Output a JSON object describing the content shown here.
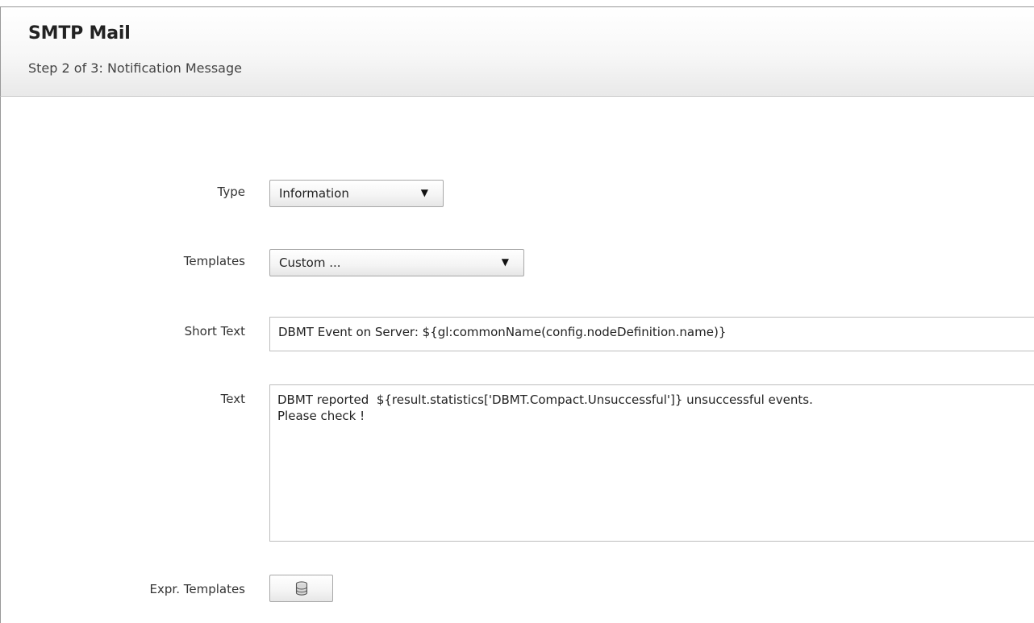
{
  "header": {
    "title": "SMTP Mail",
    "subtitle": "Step 2 of 3: Notification Message"
  },
  "form": {
    "type": {
      "label": "Type",
      "value": "Information"
    },
    "templates": {
      "label": "Templates",
      "value": "Custom ..."
    },
    "short_text": {
      "label": "Short Text",
      "value": "DBMT Event on Server: ${gl:commonName(config.nodeDefinition.name)}"
    },
    "text": {
      "label": "Text",
      "value": "DBMT reported  ${result.statistics['DBMT.Compact.Unsuccessful']} unsuccessful events.\nPlease check !"
    },
    "expr_templates": {
      "label": "Expr. Templates",
      "icon": "database-icon"
    }
  }
}
